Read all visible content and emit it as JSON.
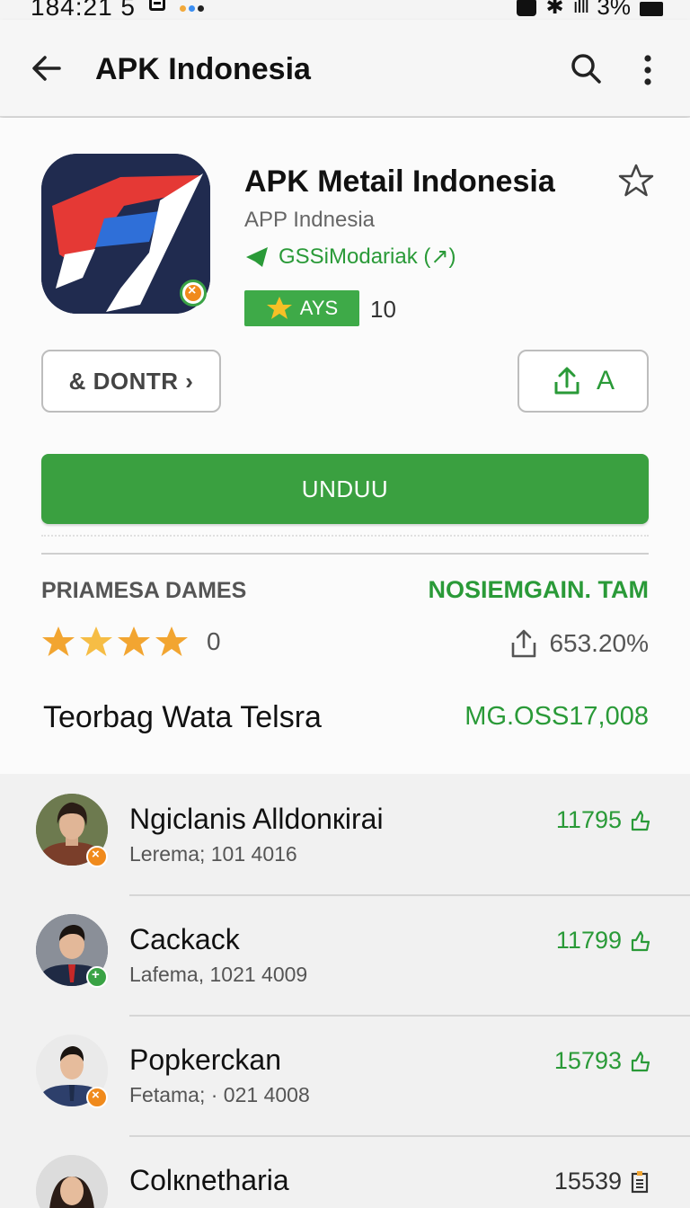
{
  "status_bar": {
    "time": "184:21 5",
    "battery": "3%",
    "colors": {
      "dot1": "#f2a93b",
      "dot2": "#3b8ef2",
      "dot3": "#222222"
    }
  },
  "app_bar": {
    "title": "APK Indonesia",
    "icons": [
      "back-arrow-icon",
      "search-icon",
      "more-vert-icon"
    ]
  },
  "app": {
    "name": "APK Metail Indonesia",
    "developer": "APP Indnesia",
    "badge": "GSSiModariak (↗)",
    "rating_label": "AYS",
    "rating_count": "10",
    "colors": {
      "icon_bg": "#202b4f",
      "icon_red": "#e53935",
      "icon_blue": "#2f6fd8",
      "accent": "#3aa040"
    }
  },
  "actions": {
    "donate_label": "& DONTR ›",
    "share_label": "A",
    "primary_label": "UNDUU"
  },
  "stats": {
    "left_label": "PRIAMESA DAMES",
    "right_label": "NOSIEMGAIN. TAM",
    "stars": 4,
    "stars_count": "0",
    "share_value": "653.20%"
  },
  "section": {
    "title": "Teorbag Wata Telsra",
    "value": "MG.OSS17,008"
  },
  "list": [
    {
      "name": "Ngiclanis Alldonкirai",
      "sub": "Lerema; 101 4016",
      "count": "11795",
      "badge_color": "#f08a1c",
      "badge_glyph": "×"
    },
    {
      "name": "Cackack",
      "sub": "Lafema, 1021 4009",
      "count": "11799",
      "badge_color": "#3aa345",
      "badge_glyph": "+"
    },
    {
      "name": "Popkerckan",
      "sub": "Fetama; · 021 4008",
      "count": "15793",
      "badge_color": "#f08a1c",
      "badge_glyph": "×"
    },
    {
      "name": "Colкnetharia",
      "sub": "",
      "count": "15539",
      "badge_color": "#3aa345",
      "badge_glyph": ""
    }
  ]
}
